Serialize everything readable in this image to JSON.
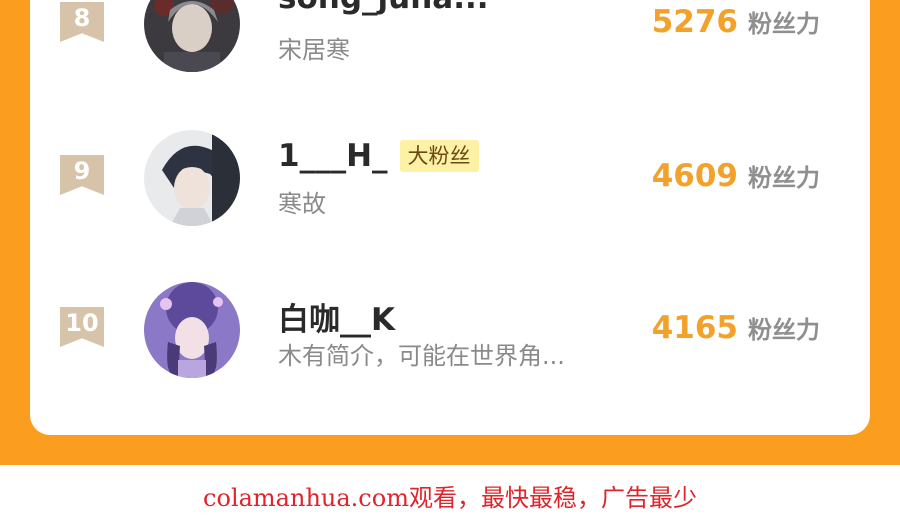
{
  "rows": [
    {
      "rank": "8",
      "name": "song_juna...",
      "badge": "",
      "bio": "宋居寒",
      "score": "5276",
      "unit": "粉丝力"
    },
    {
      "rank": "9",
      "name": "1___H_",
      "badge": "大粉丝",
      "bio": "寒故",
      "score": "4609",
      "unit": "粉丝力"
    },
    {
      "rank": "10",
      "name": "白咖__K",
      "badge": "",
      "bio": "木有简介，可能在世界角...",
      "score": "4165",
      "unit": "粉丝力"
    }
  ],
  "footer": {
    "watermark": "colamanhua.com观看，最快最稳，广告最少"
  },
  "colors": {
    "frame": "#fb9d1f",
    "score": "#f2a12a",
    "rank_badge": "#d7c3a9",
    "badge_bg": "#fdf1a6",
    "watermark": "#e0242b"
  },
  "icons": {
    "rank": "ribbon-rank-badge",
    "avatar": "user-avatar"
  }
}
